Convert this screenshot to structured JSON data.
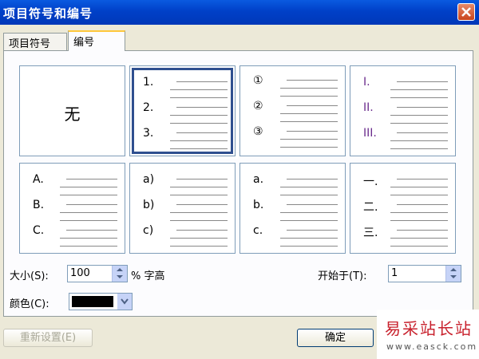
{
  "window": {
    "title": "项目符号和编号"
  },
  "tabs": [
    {
      "label": "项目符号",
      "active": false
    },
    {
      "label": "编号",
      "active": true
    }
  ],
  "gallery": {
    "none_label": "无",
    "styles": [
      {
        "markers": [
          "1.",
          "2.",
          "3."
        ],
        "selected": true
      },
      {
        "markers": [
          "①",
          "②",
          "③"
        ]
      },
      {
        "markers": [
          "I.",
          "II.",
          "III."
        ],
        "color": "#6a2c8c"
      },
      {
        "markers": [
          "A.",
          "B.",
          "C."
        ]
      },
      {
        "markers": [
          "a)",
          "b)",
          "c)"
        ]
      },
      {
        "markers": [
          "a.",
          "b.",
          "c."
        ]
      },
      {
        "markers": [
          "一.",
          "二.",
          "三."
        ]
      }
    ]
  },
  "size": {
    "label": "大小(S):",
    "value": "100",
    "suffix": "% 字高"
  },
  "start": {
    "label": "开始于(T):",
    "value": "1"
  },
  "color": {
    "label": "颜色(C):",
    "value": "#000000"
  },
  "buttons": {
    "reset": "重新设置(E)",
    "ok": "确定"
  },
  "watermark": {
    "text": "易采站长站",
    "url": "www.easck.com"
  }
}
